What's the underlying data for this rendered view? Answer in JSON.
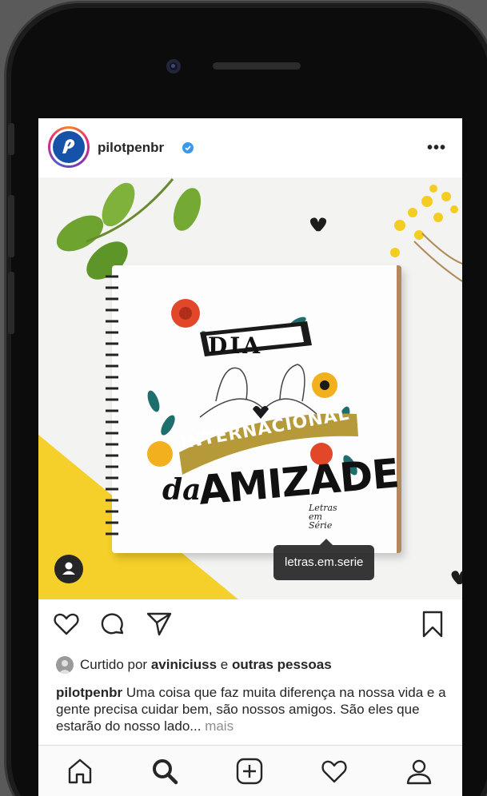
{
  "post": {
    "username": "pilotpenbr",
    "verified": true,
    "more_label": "•••",
    "image": {
      "art_dia": "DIA",
      "art_internacional": "INTERNACIONAL",
      "art_da": "da",
      "art_amizade": "AMIZADE",
      "art_signature": "Letras em Série",
      "tag_username": "letras.em.serie"
    },
    "likes": {
      "prefix": "Curtido por ",
      "user": "aviniciuss",
      "middle": " e ",
      "others": "outras pessoas"
    },
    "caption": {
      "username": "pilotpenbr",
      "text": " Uma coisa que faz muita diferença na nossa vida e a gente precisa cuidar bem, são nossos amigos. São eles que estarão do nosso lado... ",
      "more": "mais"
    }
  },
  "actions": [
    "heart-icon",
    "comment-icon",
    "share-icon",
    "bookmark-icon"
  ],
  "tabbar": [
    "home-icon",
    "search-icon",
    "add-icon",
    "activity-icon",
    "profile-icon"
  ],
  "colors": {
    "text": "#262626",
    "muted": "#8e8e8e",
    "verified": "#3897f0",
    "brand": "#1552a8"
  }
}
